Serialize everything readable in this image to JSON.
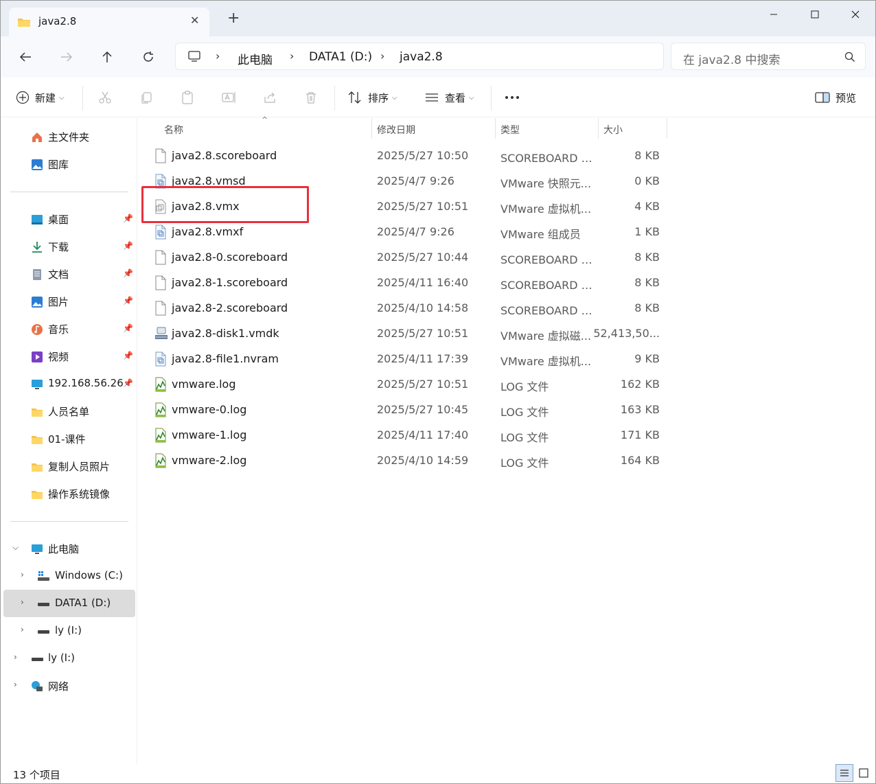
{
  "window": {
    "tab_title": "java2.8",
    "new_tab_symbol": "+",
    "close_tab_symbol": "✕"
  },
  "address": {
    "crumbs": [
      "此电脑",
      "DATA1 (D:)",
      "java2.8"
    ],
    "search_placeholder": "在 java2.8 中搜索"
  },
  "toolbar": {
    "new_label": "新建",
    "sort_label": "排序",
    "view_label": "查看",
    "more_label": "...",
    "preview_label": "预览"
  },
  "sidebar": {
    "quick": [
      {
        "label": "主文件夹",
        "icon": "home-icon"
      },
      {
        "label": "图库",
        "icon": "gallery-icon"
      }
    ],
    "pinned": [
      {
        "label": "桌面",
        "icon": "desktop-icon",
        "pinned": true
      },
      {
        "label": "下载",
        "icon": "download-icon",
        "pinned": true
      },
      {
        "label": "文档",
        "icon": "documents-icon",
        "pinned": true
      },
      {
        "label": "图片",
        "icon": "pictures-icon",
        "pinned": true
      },
      {
        "label": "音乐",
        "icon": "music-icon",
        "pinned": true
      },
      {
        "label": "视频",
        "icon": "videos-icon",
        "pinned": true
      },
      {
        "label": "192.168.56.26",
        "icon": "network-drive-icon",
        "pinned": true
      },
      {
        "label": "人员名单",
        "icon": "folder-icon",
        "pinned": false
      },
      {
        "label": "01-课件",
        "icon": "folder-icon",
        "pinned": false
      },
      {
        "label": "复制人员照片",
        "icon": "folder-icon",
        "pinned": false
      },
      {
        "label": "操作系统镜像",
        "icon": "folder-icon",
        "pinned": false
      }
    ],
    "tree": {
      "this_pc": "此电脑",
      "drives": [
        {
          "label": "Windows (C:)",
          "selected": false
        },
        {
          "label": "DATA1 (D:)",
          "selected": true
        },
        {
          "label": "ly (I:)",
          "selected": false
        }
      ],
      "removable": "ly (I:)",
      "network": "网络"
    }
  },
  "columns": {
    "name": "名称",
    "date": "修改日期",
    "type": "类型",
    "size": "大小"
  },
  "files": [
    {
      "name": "java2.8.scoreboard",
      "date": "2025/5/27 10:50",
      "type": "SCOREBOARD 文...",
      "size": "8 KB",
      "icon": "blank-file-icon"
    },
    {
      "name": "java2.8.vmsd",
      "date": "2025/4/7 9:26",
      "type": "VMware 快照元...",
      "size": "0 KB",
      "icon": "vmware-file-icon"
    },
    {
      "name": "java2.8.vmx",
      "date": "2025/5/27 10:51",
      "type": "VMware 虚拟机...",
      "size": "4 KB",
      "icon": "vmx-file-icon"
    },
    {
      "name": "java2.8.vmxf",
      "date": "2025/4/7 9:26",
      "type": "VMware 组成员",
      "size": "1 KB",
      "icon": "vmware-file-icon"
    },
    {
      "name": "java2.8-0.scoreboard",
      "date": "2025/5/27 10:44",
      "type": "SCOREBOARD 文...",
      "size": "8 KB",
      "icon": "blank-file-icon"
    },
    {
      "name": "java2.8-1.scoreboard",
      "date": "2025/4/11 16:40",
      "type": "SCOREBOARD 文...",
      "size": "8 KB",
      "icon": "blank-file-icon"
    },
    {
      "name": "java2.8-2.scoreboard",
      "date": "2025/4/10 14:58",
      "type": "SCOREBOARD 文...",
      "size": "8 KB",
      "icon": "blank-file-icon"
    },
    {
      "name": "java2.8-disk1.vmdk",
      "date": "2025/5/27 10:51",
      "type": "VMware 虚拟磁...",
      "size": "52,413,50...",
      "icon": "disk-file-icon"
    },
    {
      "name": "java2.8-file1.nvram",
      "date": "2025/4/11 17:39",
      "type": "VMware 虚拟机...",
      "size": "9 KB",
      "icon": "vmware-file-icon"
    },
    {
      "name": "vmware.log",
      "date": "2025/5/27 10:51",
      "type": "LOG 文件",
      "size": "162 KB",
      "icon": "log-file-icon"
    },
    {
      "name": "vmware-0.log",
      "date": "2025/5/27 10:45",
      "type": "LOG 文件",
      "size": "163 KB",
      "icon": "log-file-icon"
    },
    {
      "name": "vmware-1.log",
      "date": "2025/4/11 17:40",
      "type": "LOG 文件",
      "size": "171 KB",
      "icon": "log-file-icon"
    },
    {
      "name": "vmware-2.log",
      "date": "2025/4/10 14:59",
      "type": "LOG 文件",
      "size": "164 KB",
      "icon": "log-file-icon"
    }
  ],
  "status": {
    "item_count": "13 个项目"
  },
  "colors": {
    "highlight": "#e8303b",
    "selected_bg": "#dcdcdc",
    "accent": "#0067c0"
  }
}
